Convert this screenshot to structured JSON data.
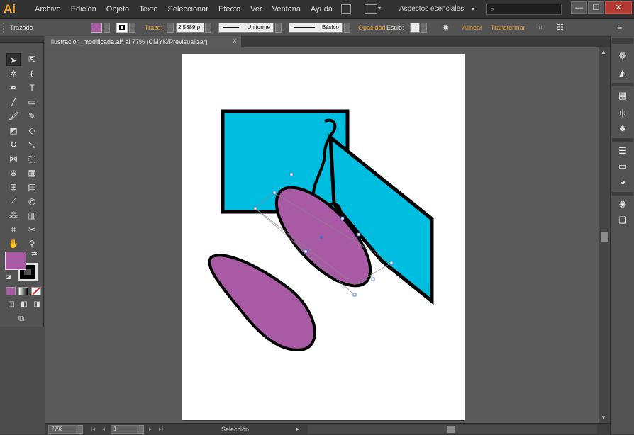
{
  "app": {
    "logo": "Ai",
    "menu": [
      "Archivo",
      "Edición",
      "Objeto",
      "Texto",
      "Seleccionar",
      "Efecto",
      "Ver",
      "Ventana",
      "Ayuda"
    ],
    "workspace": "Aspectos esenciales",
    "search_placeholder": ""
  },
  "window_controls": {
    "minimize": "—",
    "restore": "❐",
    "close": "✕"
  },
  "control_bar": {
    "selection_type": "Trazado",
    "fill_color": "#a95aa4",
    "stroke_label": "Trazo:",
    "stroke_weight": "2.5889 p",
    "profile_label": "Uniforme",
    "brush_label": "Básico",
    "opacity_label": "Opacidad:",
    "style_label": "Estilo:",
    "align_label": "Alinear",
    "transform_label": "Transformar"
  },
  "document": {
    "tab_title": "ilustracion_modificada.ai* al 77% (CMYK/Previsualizar)",
    "tab_close": "×"
  },
  "artwork": {
    "cyan": "#00bee0",
    "magenta": "#a95aa4",
    "outline": "#000000"
  },
  "tools": {
    "fill_color": "#a95aa4",
    "stroke_color": "#000000",
    "icons": [
      "selection-tool",
      "direct-selection-tool",
      "magic-wand-tool",
      "lasso-tool",
      "pen-tool",
      "type-tool",
      "line-tool",
      "rectangle-tool",
      "paintbrush-tool",
      "pencil-tool",
      "blob-brush-tool",
      "eraser-tool",
      "rotate-tool",
      "scale-tool",
      "width-tool",
      "free-transform-tool",
      "shape-builder-tool",
      "perspective-grid-tool",
      "mesh-tool",
      "gradient-tool",
      "eyedropper-tool",
      "blend-tool",
      "symbol-sprayer-tool",
      "column-graph-tool",
      "artboard-tool",
      "slice-tool",
      "hand-tool",
      "zoom-tool"
    ]
  },
  "status": {
    "zoom": "77%",
    "artboard_number": "1",
    "tool_name": "Selección"
  }
}
